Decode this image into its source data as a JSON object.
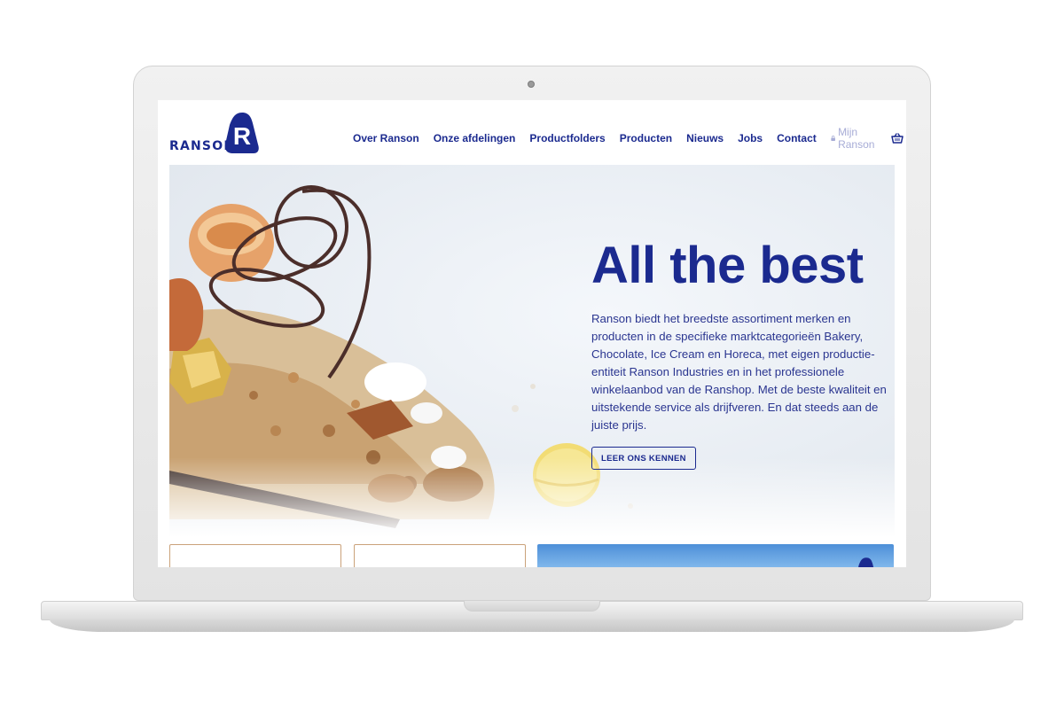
{
  "brand": {
    "name": "RANSON",
    "mark": "R",
    "color": "#1b2a8f"
  },
  "nav": {
    "items": [
      "Over Ranson",
      "Onze afdelingen",
      "Productfolders",
      "Producten",
      "Nieuws",
      "Jobs",
      "Contact"
    ],
    "account_label": "Mijn Ranson",
    "account_icon": "lock-icon",
    "cart_icon": "basket-icon",
    "language": "nl"
  },
  "hero": {
    "title": "All the best",
    "text": "Ranson biedt het breedste assortiment merken en producten in de specifieke marktcategorieën Bakery, Chocolate, Ice Cream en Horeca, met eigen productie-entiteit Ranson Industries en in het professionele winkelaanbod van de Ranshop. Met de beste kwaliteit en uitstekende service als drijfveren. En dat steeds aan de juiste prijs.",
    "button_label": "LEER ONS KENNEN"
  },
  "colors": {
    "accent": "#1b2a8f",
    "card_border": "#caa27a",
    "banner_blue": "#4d8fd8"
  }
}
